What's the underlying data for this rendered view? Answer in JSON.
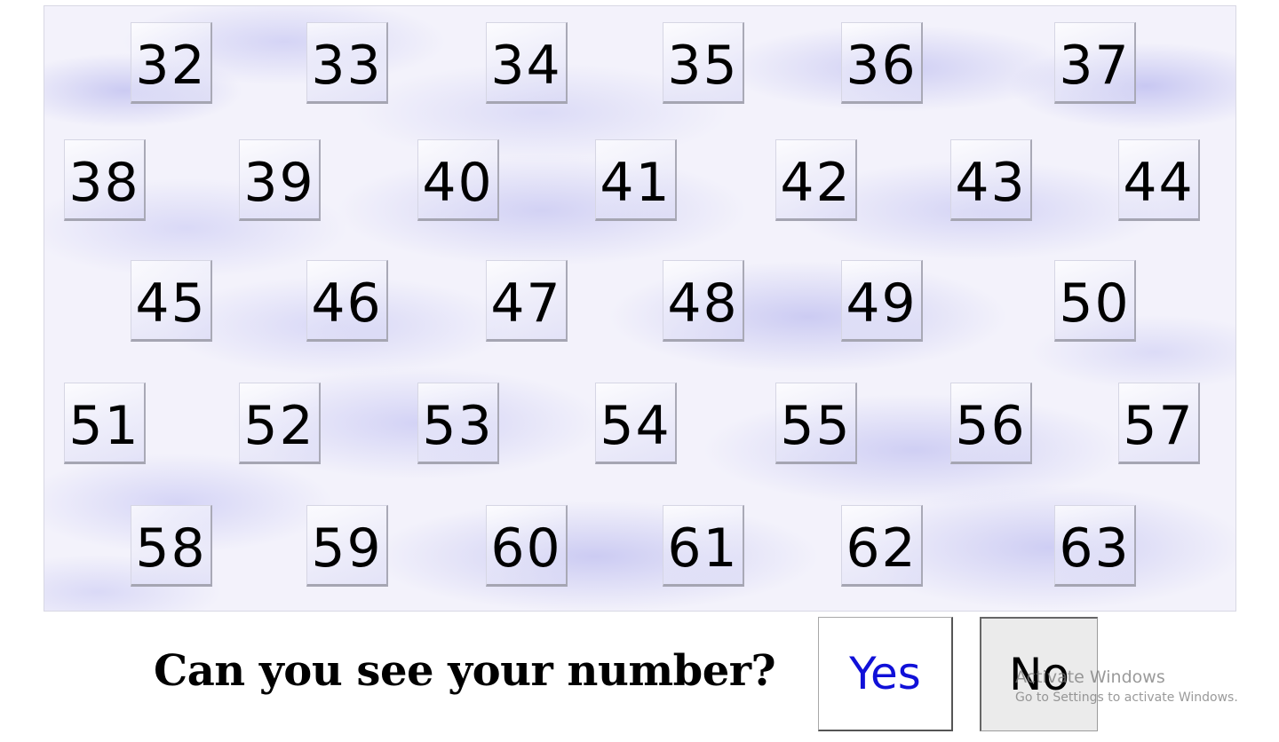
{
  "grid": {
    "numbers": [
      [
        "32",
        "33",
        "34",
        "35",
        "36",
        "37"
      ],
      [
        "38",
        "39",
        "40",
        "41",
        "42",
        "43",
        "44"
      ],
      [
        "45",
        "46",
        "47",
        "48",
        "49",
        "50"
      ],
      [
        "51",
        "52",
        "53",
        "54",
        "55",
        "56",
        "57"
      ],
      [
        "58",
        "59",
        "60",
        "61",
        "62",
        "63"
      ]
    ]
  },
  "prompt": {
    "question": "Can you see your number?",
    "yes_label": "Yes",
    "no_label": "No"
  },
  "watermark": {
    "title": "Activate Windows",
    "subtitle": "Go to Settings to activate Windows."
  },
  "colors": {
    "yes_text": "#1010d8",
    "no_background": "#ebebeb",
    "cloud_tint": "#aaaaeb"
  }
}
